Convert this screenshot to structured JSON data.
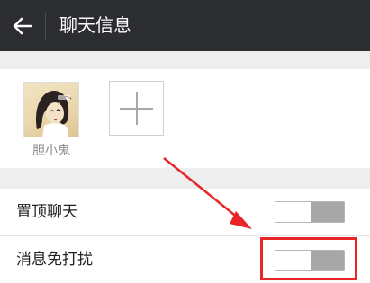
{
  "header": {
    "title": "聊天信息"
  },
  "members": {
    "items": [
      {
        "name": "胆小鬼",
        "avatar": "cartoon-girl-avatar"
      }
    ],
    "add_icon": "plus-icon"
  },
  "settings": [
    {
      "label": "置顶聊天",
      "toggle_on": false
    },
    {
      "label": "消息免打扰",
      "toggle_on": false
    }
  ],
  "colors": {
    "header_bg": "#2c2d31",
    "section_gap": "#eeeeee",
    "annotation": "#e8262a",
    "toggle_off": "#a7a7a7"
  },
  "annotation": {
    "arrow_icon": "red-arrow",
    "box": "red-highlight-box"
  }
}
